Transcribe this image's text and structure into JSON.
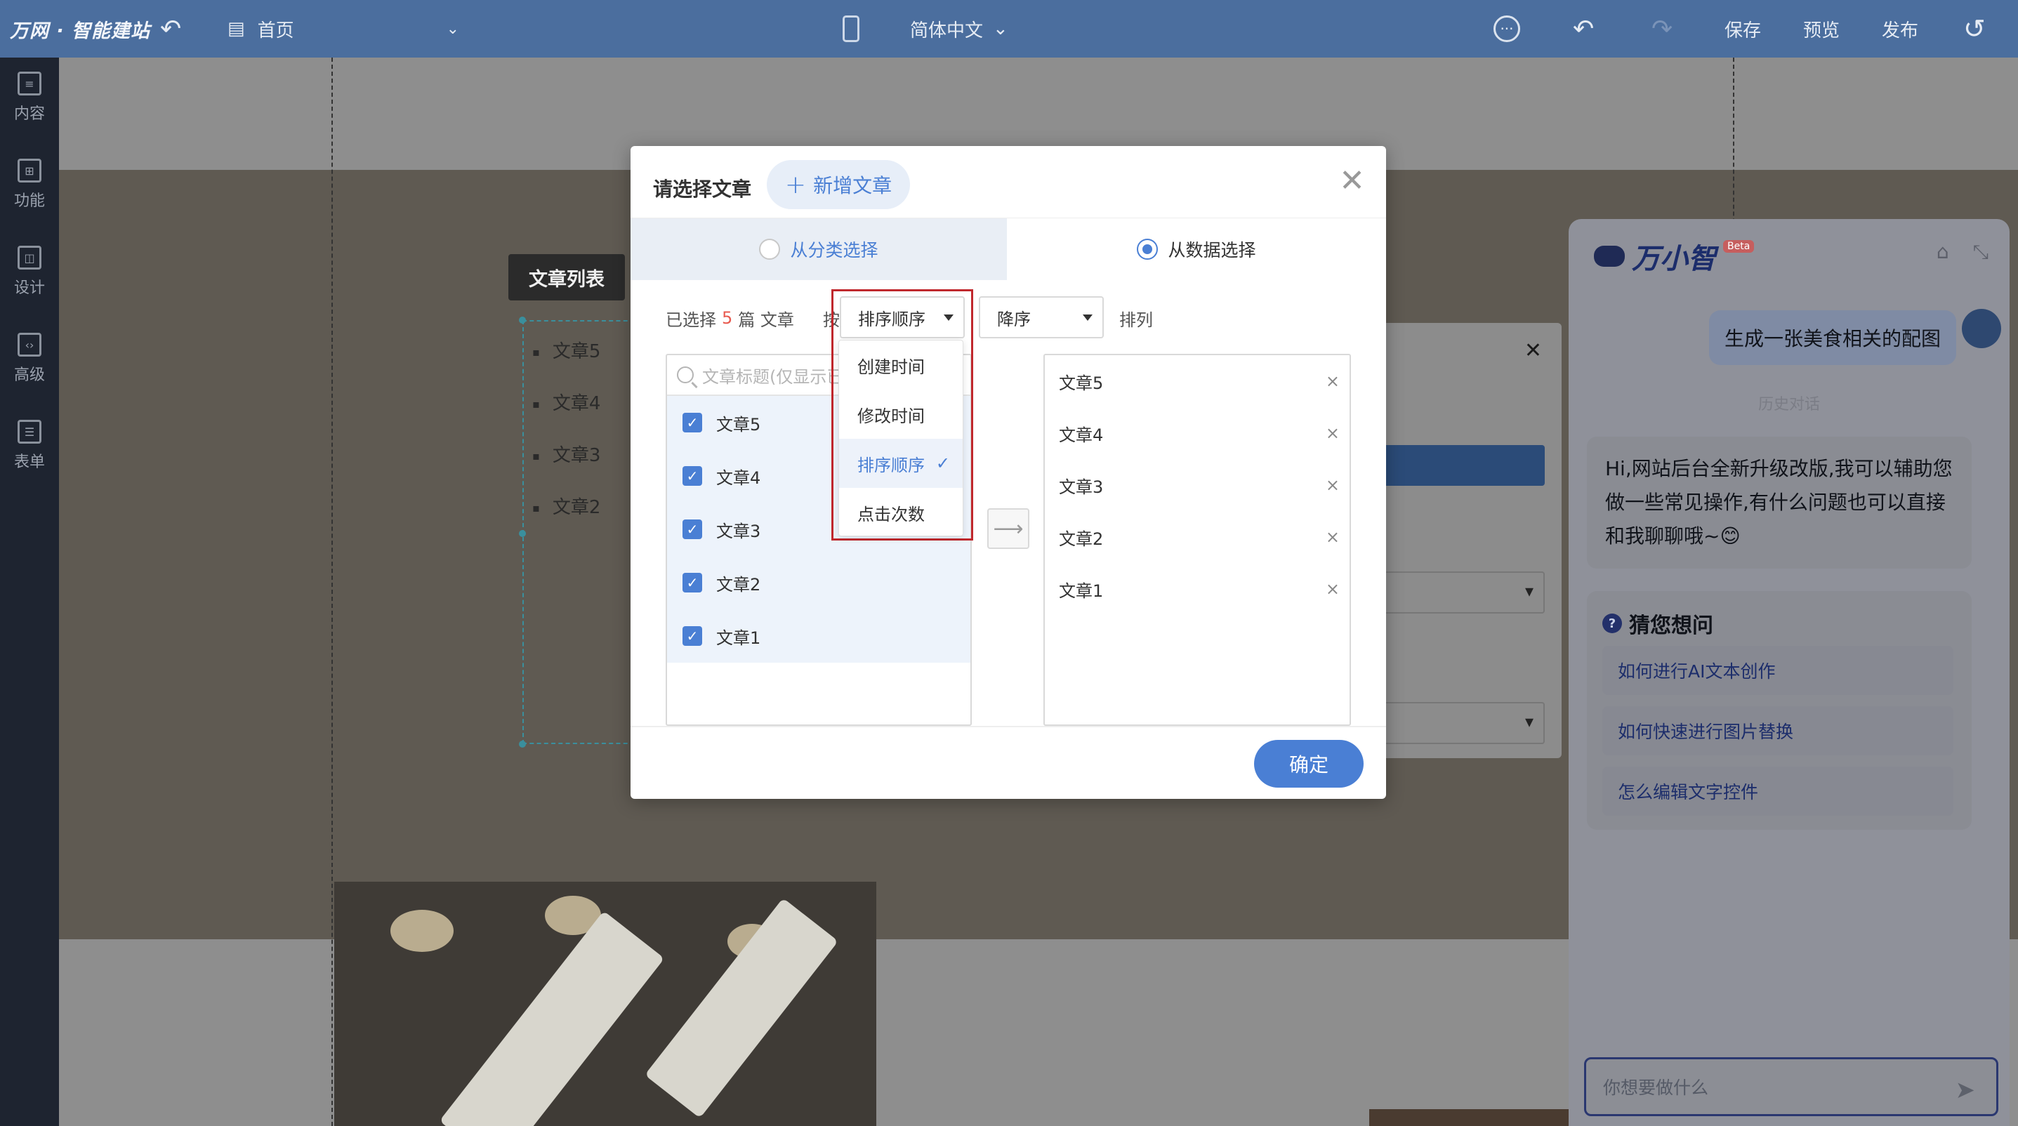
{
  "topbar": {
    "logo": "万网 · 智能建站",
    "page_selector": "首页",
    "language": "简体中文",
    "more_icon": "···",
    "save": "保存",
    "preview": "预览",
    "publish": "发布"
  },
  "sidebar": {
    "items": [
      {
        "label": "内容",
        "icon": "document-icon"
      },
      {
        "label": "功能",
        "icon": "grid-icon"
      },
      {
        "label": "设计",
        "icon": "layout-icon"
      },
      {
        "label": "高级",
        "icon": "code-icon"
      },
      {
        "label": "表单",
        "icon": "form-icon"
      }
    ]
  },
  "canvas": {
    "list_label": "文章列表",
    "articles": [
      "文章5",
      "文章4",
      "文章3",
      "文章2"
    ]
  },
  "ai_panel": {
    "name": "万小智",
    "beta": "Beta",
    "user_message": "生成一张美食相关的配图",
    "history_label": "历史对话",
    "bot_message": "Hi,网站后台全新升级改版,我可以辅助您做一些常见操作,有什么问题也可以直接和我聊聊哦~😊",
    "guess_title": "猜您想问",
    "questions": [
      "如何进行AI文本创作",
      "如何快速进行图片替换",
      "怎么编辑文字控件"
    ],
    "input_placeholder": "你想要做什么"
  },
  "modal": {
    "title": "请选择文章",
    "add_button": "新增文章",
    "tabs": {
      "by_category": "从分类选择",
      "by_data": "从数据选择",
      "selected": "by_data"
    },
    "controls": {
      "selected_prefix": "已选择",
      "selected_count": "5",
      "selected_suffix": "篇 文章",
      "by": "按",
      "sort_field": "排序顺序",
      "sort_order": "降序",
      "arrange": "排列"
    },
    "search_placeholder": "文章标题(仅显示已",
    "left_list": [
      "文章5",
      "文章4",
      "文章3",
      "文章2",
      "文章1"
    ],
    "right_list": [
      "文章5",
      "文章4",
      "文章3",
      "文章2",
      "文章1"
    ],
    "remove_icon": "×",
    "transfer_icon": "⟶",
    "confirm": "确定"
  },
  "dropdown": {
    "options": [
      "创建时间",
      "修改时间",
      "排序顺序",
      "点击次数"
    ],
    "selected_index": 2,
    "tick": "✓"
  },
  "colors": {
    "topbar": "#4b6e9e",
    "sidebar": "#1e2430",
    "accent": "#4a7fd4",
    "highlight_border": "#c0282d",
    "count": "#e85a4f"
  }
}
